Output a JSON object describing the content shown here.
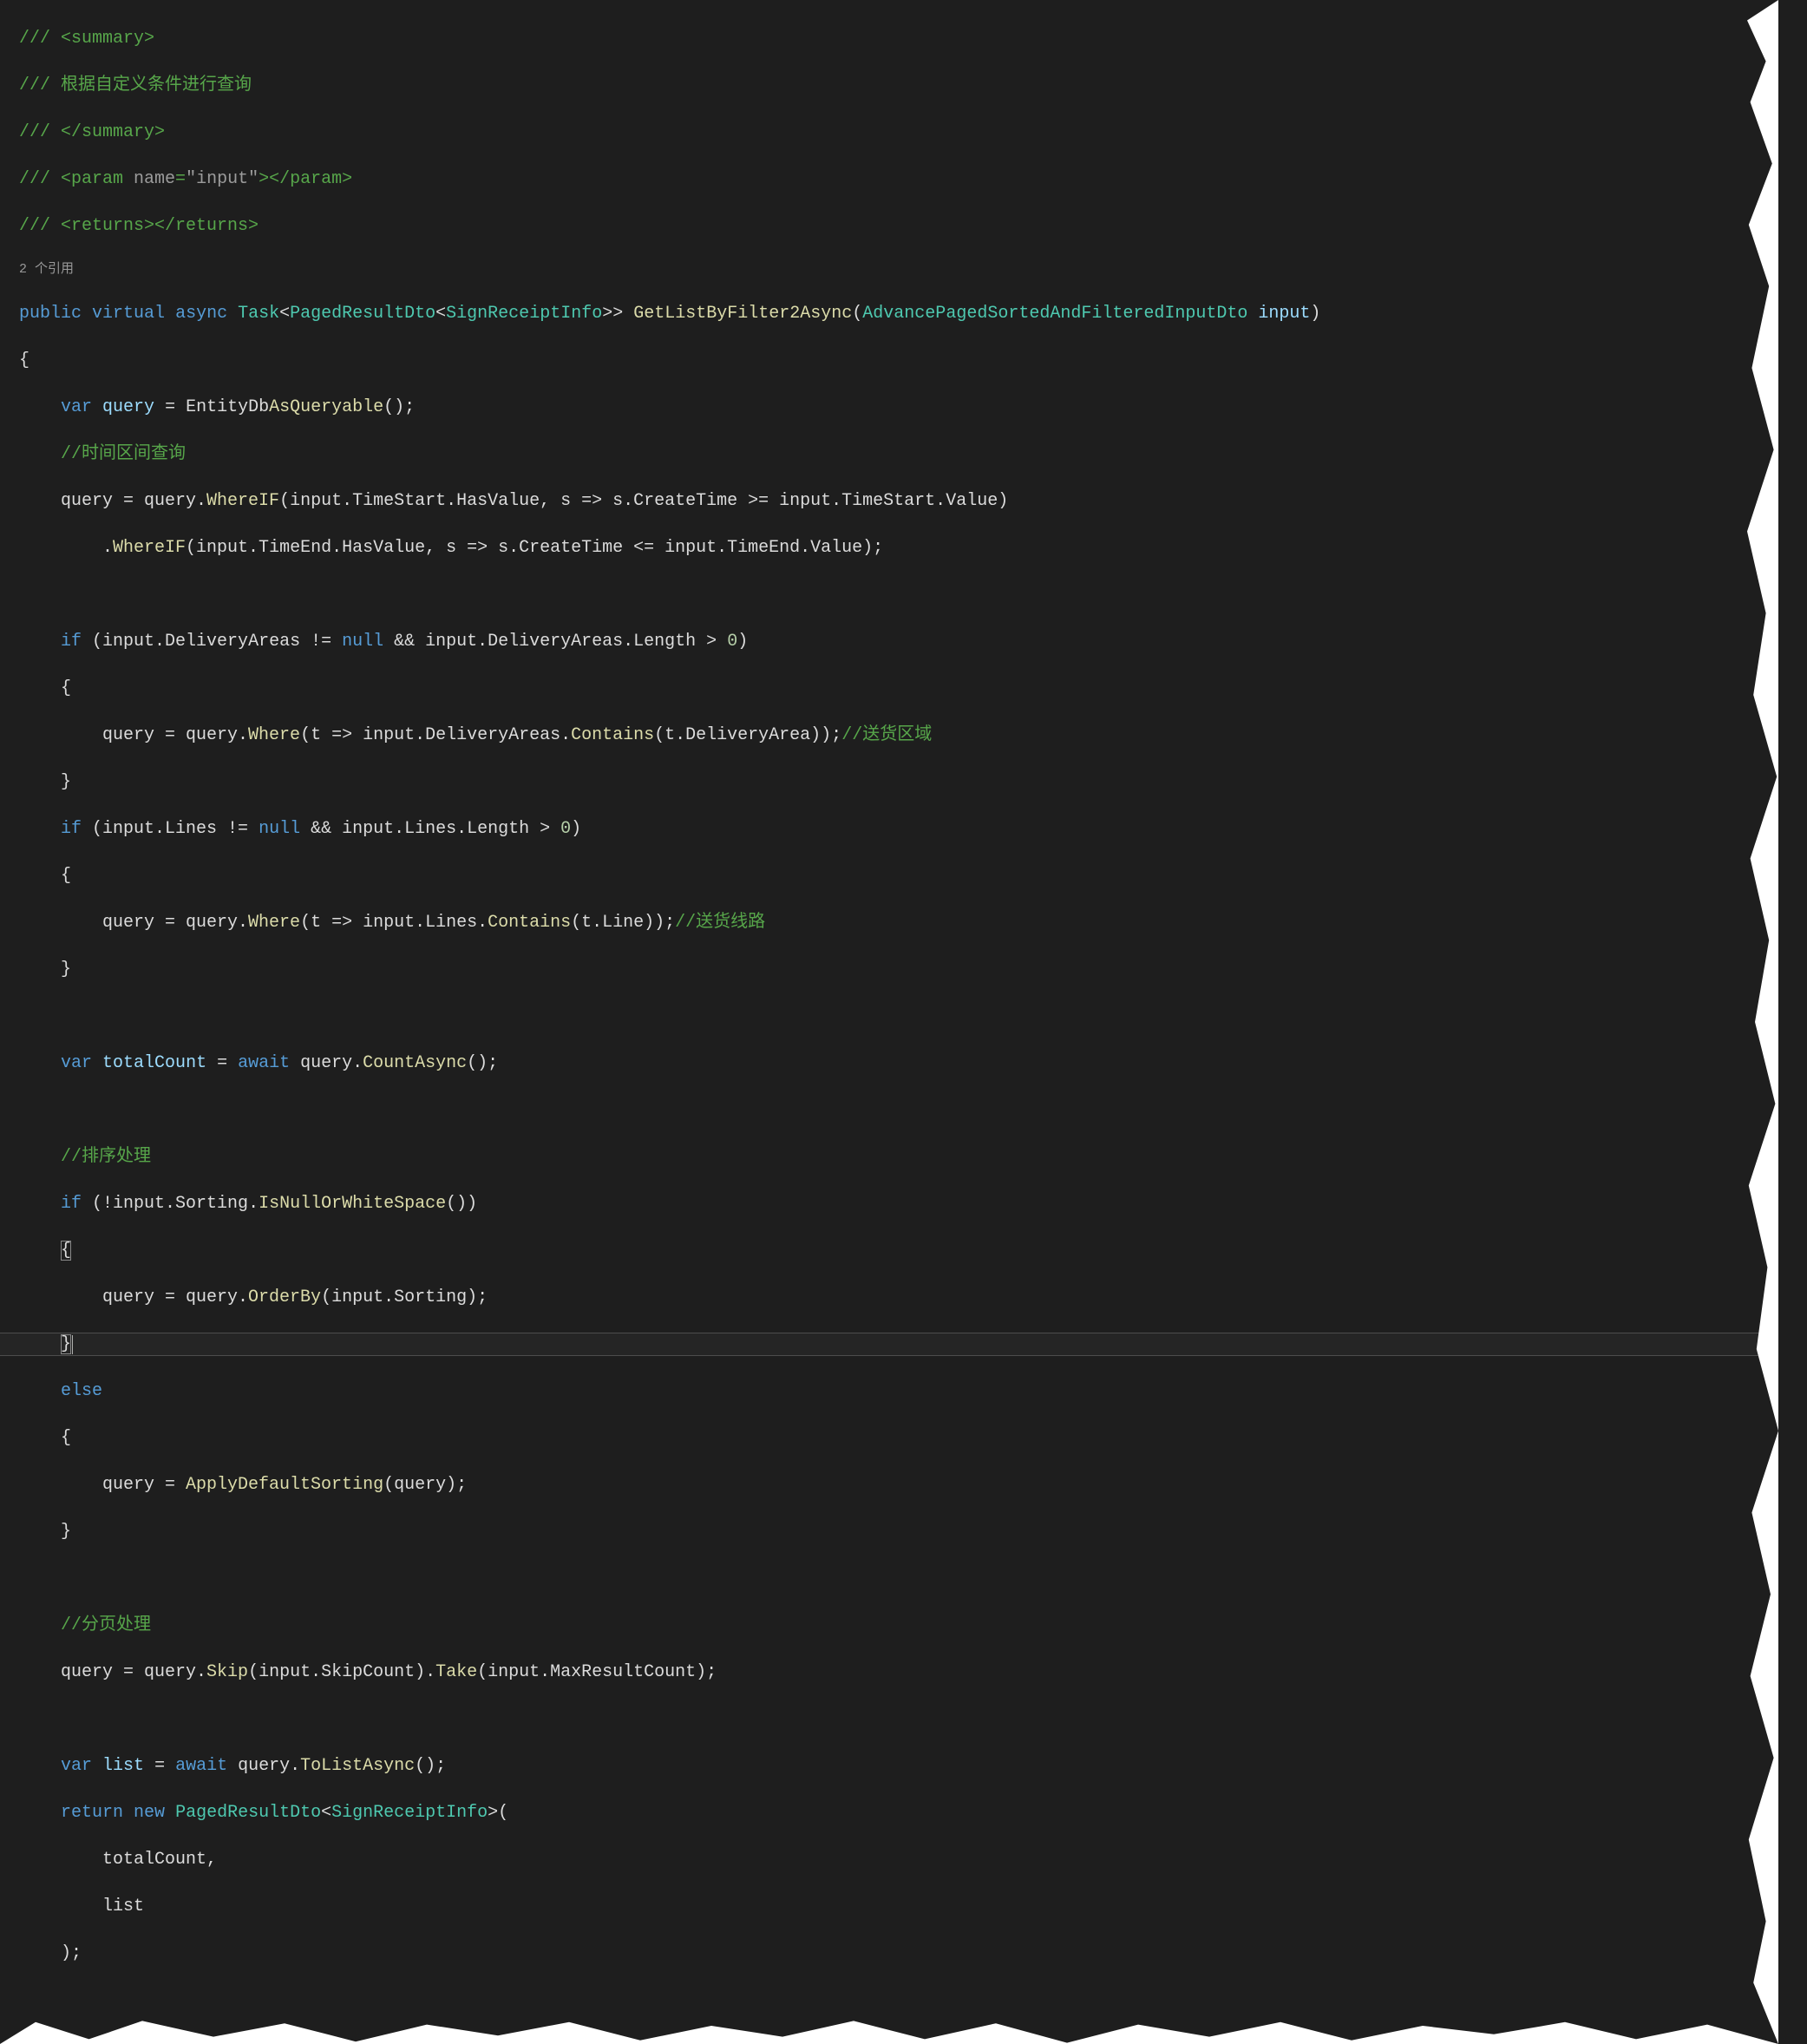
{
  "colors": {
    "background": "#1e1e1e",
    "comment": "#57A64A",
    "keyword": "#569CD6",
    "type": "#4EC9B0",
    "method": "#DCDCAA",
    "identifier": "#9CDCFE",
    "string": "#D69D85",
    "number": "#B5CEA8",
    "default": "#dcdcdc",
    "codelens": "#999999"
  },
  "codelens": "2 个引用",
  "code": {
    "l01": "/// <summary>",
    "l02_a": "/// ",
    "l02_b": "根据自定义条件进行查询",
    "l03": "/// </summary>",
    "l04_a": "/// <param ",
    "l04_name": "name",
    "l04_eq": "=",
    "l04_val": "\"input\"",
    "l04_b": "></param>",
    "l05": "/// <returns></returns>",
    "l06": {
      "public": "public",
      "virtual": "virtual",
      "async": "async",
      "Task": "Task",
      "lt": "<",
      "PagedResultDto": "PagedResultDto",
      "SignReceiptInfo": "SignReceiptInfo",
      "gt": ">>",
      "sp": " ",
      "Method": "GetListByFilter2Async",
      "op": "(",
      "ParamType": "AdvancePagedSortedAndFilteredInputDto",
      "param": "input",
      "cp": ")"
    },
    "l07": "{",
    "l08": {
      "var": "var",
      "query": "query",
      "eq": " = ",
      "EntityDb": "EntityDb",
      ".": ".",
      "AsQueryable": "AsQueryable",
      "end": "();"
    },
    "l09": "//时间区间查询",
    "l10": {
      "a": "query = query.",
      "WhereIF": "WhereIF",
      "b": "(input.TimeStart.HasValue, s => s.CreateTime >= input.TimeStart.Value)"
    },
    "l11": {
      "a": ".",
      "WhereIF": "WhereIF",
      "b": "(input.TimeEnd.HasValue, s => s.CreateTime <= input.TimeEnd.Value);"
    },
    "l12": "",
    "l13": {
      "if": "if",
      "a": " (input.DeliveryAreas != ",
      "null": "null",
      "b": " && input.DeliveryAreas.Length > ",
      "zero": "0",
      "c": ")"
    },
    "l14": "{",
    "l15": {
      "a": "query = query.",
      "Where": "Where",
      "b": "(t => input.DeliveryAreas.",
      "Contains": "Contains",
      "c": "(t.DeliveryArea));",
      "comment": "//送货区域"
    },
    "l16": "}",
    "l17": {
      "if": "if",
      "a": " (input.Lines != ",
      "null": "null",
      "b": " && input.Lines.Length > ",
      "zero": "0",
      "c": ")"
    },
    "l18": "{",
    "l19": {
      "a": "query = query.",
      "Where": "Where",
      "b": "(t => input.Lines.",
      "Contains": "Contains",
      "c": "(t.Line));",
      "comment": "//送货线路"
    },
    "l20": "}",
    "l21": "",
    "l22": {
      "var": "var",
      "tc": "totalCount",
      "eq": " = ",
      "await": "await",
      "sp": " query.",
      "CountAsync": "CountAsync",
      "end": "();"
    },
    "l23": "",
    "l24": "//排序处理",
    "l25": {
      "if": "if",
      "a": " (!input.Sorting.",
      "IsNull": "IsNullOrWhiteSpace",
      "b": "())"
    },
    "l26": "{",
    "l27": {
      "a": "query = query.",
      "OrderBy": "OrderBy",
      "b": "(input.Sorting);"
    },
    "l28": "}",
    "l29": "else",
    "l30": "{",
    "l31": {
      "a": "query = ",
      "ApplyDefaultSorting": "ApplyDefaultSorting",
      "b": "(query);"
    },
    "l32": "}",
    "l33": "",
    "l34": "//分页处理",
    "l35": {
      "a": "query = query.",
      "Skip": "Skip",
      "b": "(input.SkipCount).",
      "Take": "Take",
      "c": "(input.MaxResultCount);"
    },
    "l36": "",
    "l37": {
      "var": "var",
      "list": "list",
      "eq": " = ",
      "await": "await",
      "a": " query.",
      "ToListAsync": "ToListAsync",
      "b": "();"
    },
    "l38": {
      "return": "return",
      "sp": " ",
      "new": "new",
      "sp2": " ",
      "PagedResultDto": "PagedResultDto",
      "lt": "<",
      "SignReceiptInfo": "SignReceiptInfo",
      "gt": ">("
    },
    "l39": "totalCount,",
    "l40": "list",
    "l41": ");"
  }
}
